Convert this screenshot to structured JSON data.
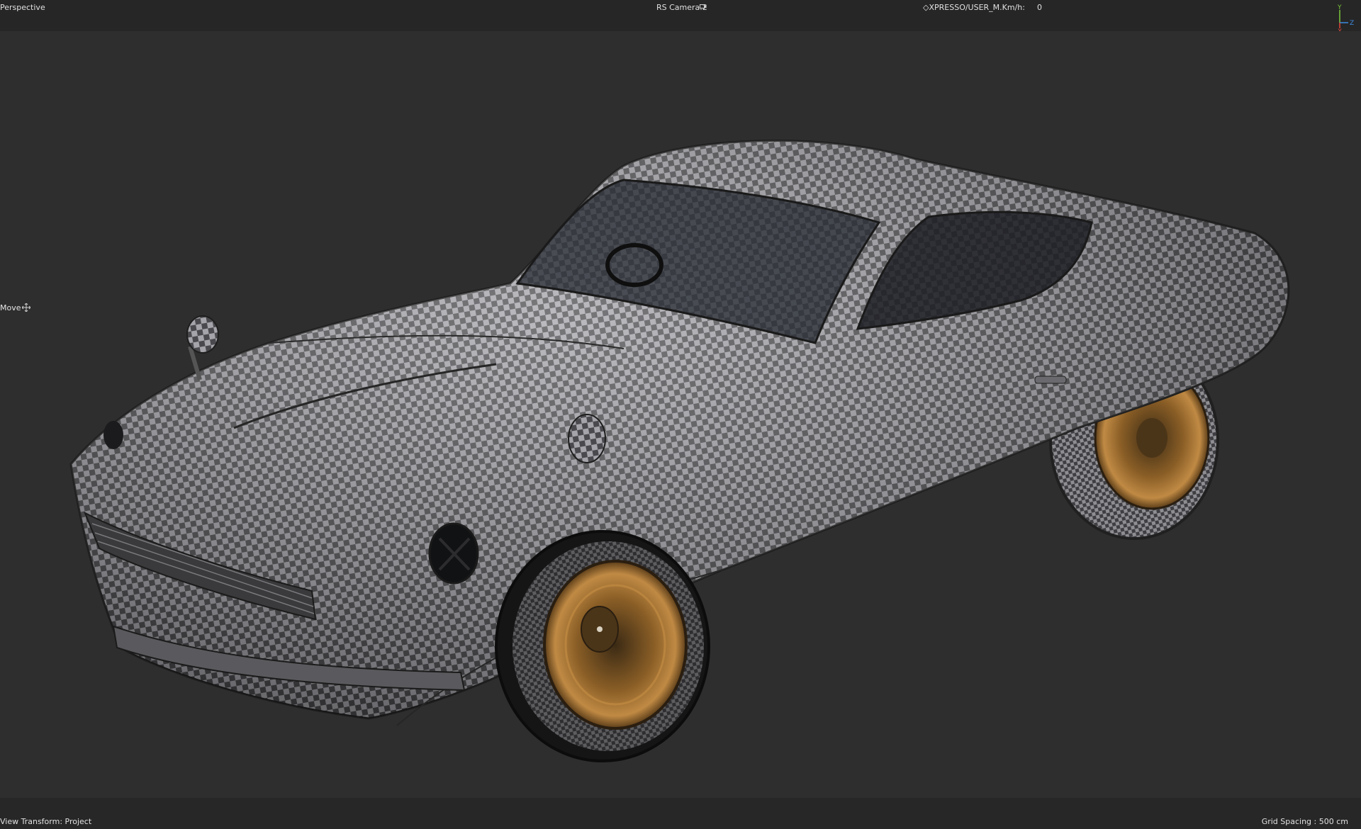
{
  "viewport": {
    "view_name": "Perspective",
    "camera_name": "RS Camera.2",
    "xpresso_label": "XPRESSO/USER_M.Km/h:",
    "xpresso_value": "0",
    "active_tool": "Move",
    "view_transform": "View Transform: Project",
    "grid_spacing": "Grid Spacing : 500 cm"
  },
  "gizmo": {
    "y": "Y",
    "z": "Z",
    "x": "X"
  },
  "icons": {
    "camera": "camera-icon",
    "move": "move-icon",
    "axis": "axis-gizmo-icon",
    "diamond": "diamond-icon"
  },
  "colors": {
    "background": "#2d2d2d",
    "bar": "#262626",
    "checker_light": "#a4a4aa",
    "checker_dark": "#4a4a4e",
    "rim": "#9a6a2c",
    "axis_x": "#e2463c",
    "axis_y": "#7cc63c",
    "axis_z": "#3c8ce2"
  }
}
